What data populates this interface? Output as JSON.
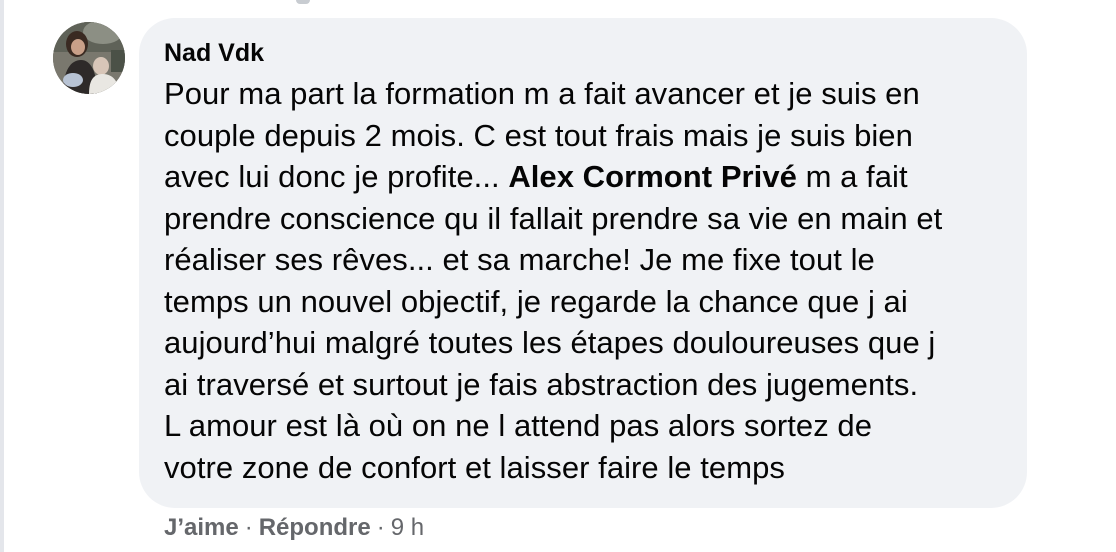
{
  "comment": {
    "author": "Nad Vdk",
    "text_lines": [
      [
        "Pour ma part la formation m a fait avancer et je suis en"
      ],
      [
        "couple depuis 2 mois. C est tout frais mais je suis bien"
      ],
      [
        "avec lui donc je profite... ",
        "Alex Cormont Privé",
        " m a fait"
      ],
      [
        "prendre conscience qu il fallait prendre sa vie en main et"
      ],
      [
        "réaliser ses rêves... et sa marche! Je me fixe tout le"
      ],
      [
        "temps un nouvel objectif, je regarde la chance que j ai"
      ],
      [
        "aujourd’hui malgré toutes les étapes douloureuses que j"
      ],
      [
        "ai traversé et surtout je fais abstraction des jugements."
      ],
      [
        "L amour est là où on ne l attend pas alors sortez de"
      ],
      [
        "votre zone de confort et laisser faire le temps"
      ]
    ],
    "mention": "Alex Cormont Privé"
  },
  "actions": {
    "like_label": "J’aime",
    "reply_label": "Répondre",
    "separator": "·",
    "timestamp": "9 h"
  },
  "icons": {
    "avatar": "profile-photo"
  },
  "colors": {
    "bubble_bg": "#f0f2f5",
    "text": "#050505",
    "secondary_text": "#65676b"
  }
}
